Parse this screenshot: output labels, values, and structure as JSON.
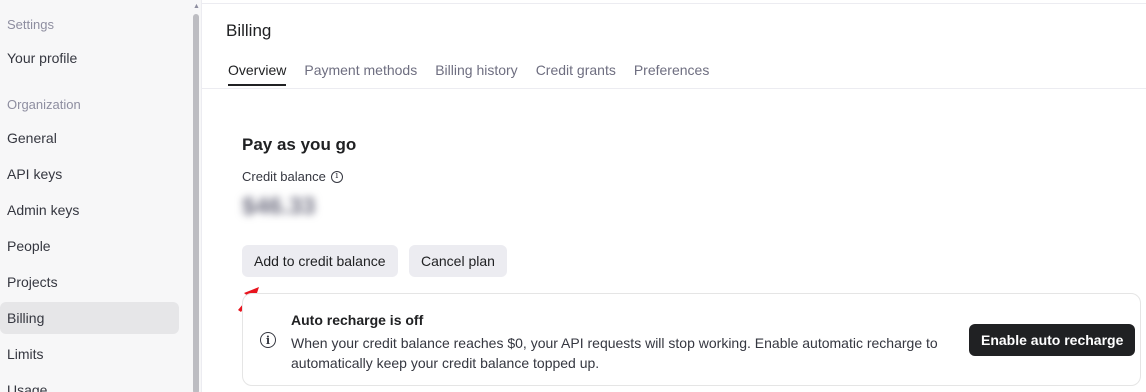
{
  "sidebar": {
    "settings_heading": "Settings",
    "your_profile": "Your profile",
    "organization_heading": "Organization",
    "items": [
      {
        "label": "General"
      },
      {
        "label": "API keys"
      },
      {
        "label": "Admin keys"
      },
      {
        "label": "People"
      },
      {
        "label": "Projects"
      },
      {
        "label": "Billing",
        "active": true
      },
      {
        "label": "Limits"
      },
      {
        "label": "Usage"
      }
    ]
  },
  "page": {
    "title": "Billing",
    "tabs": [
      {
        "label": "Overview",
        "active": true
      },
      {
        "label": "Payment methods"
      },
      {
        "label": "Billing history"
      },
      {
        "label": "Credit grants"
      },
      {
        "label": "Preferences"
      }
    ]
  },
  "overview": {
    "plan_title": "Pay as you go",
    "credit_label": "Credit balance",
    "credit_value_blurred": "$46.33",
    "add_credit_button": "Add to credit balance",
    "cancel_plan_button": "Cancel plan"
  },
  "alert": {
    "title": "Auto recharge is off",
    "body": "When your credit balance reaches $0, your API requests will stop working. Enable automatic recharge to automatically keep your credit balance topped up.",
    "enable_button": "Enable auto recharge"
  },
  "colors": {
    "sidebar_bg": "#f7f7f8",
    "active_item_bg": "#e6e6e8",
    "primary_button": "#202123",
    "secondary_button": "#ececf1",
    "annotation_arrow": "#e8141e"
  }
}
